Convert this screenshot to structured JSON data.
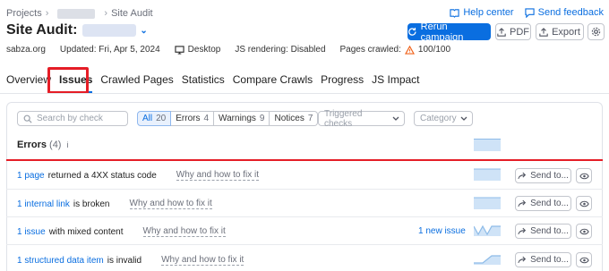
{
  "breadcrumb": {
    "root": "Projects",
    "current": "Site Audit",
    "separator": "›"
  },
  "header": {
    "title": "Site Audit:",
    "chevron": "⌄"
  },
  "top_links": {
    "help": "Help center",
    "feedback": "Send feedback"
  },
  "buttons": {
    "rerun": "Rerun campaign",
    "pdf": "PDF",
    "export": "Export"
  },
  "meta": {
    "domain": "sabza.org",
    "updated": "Updated: Fri, Apr 5, 2024",
    "device": "Desktop",
    "js": "JS rendering: Disabled",
    "crawled_label": "Pages crawled:",
    "crawled_value": "100/100"
  },
  "tabs": [
    {
      "label": "Overview"
    },
    {
      "label": "Issues"
    },
    {
      "label": "Crawled Pages"
    },
    {
      "label": "Statistics"
    },
    {
      "label": "Compare Crawls"
    },
    {
      "label": "Progress"
    },
    {
      "label": "JS Impact"
    }
  ],
  "filters": {
    "search_placeholder": "Search by check",
    "segments": [
      {
        "label": "All",
        "count": "20"
      },
      {
        "label": "Errors",
        "count": "4"
      },
      {
        "label": "Warnings",
        "count": "9"
      },
      {
        "label": "Notices",
        "count": "7"
      }
    ],
    "triggered": "Triggered checks",
    "category": "Category"
  },
  "section": {
    "title": "Errors",
    "count": "(4)",
    "info": "i"
  },
  "rows": [
    {
      "link": "1 page",
      "text": "returned a 4XX status code",
      "why": "Why and how to fix it",
      "new": "",
      "send": "Send to..."
    },
    {
      "link": "1 internal link",
      "text": "is broken",
      "why": "Why and how to fix it",
      "new": "",
      "send": "Send to..."
    },
    {
      "link": "1 issue",
      "text": "with mixed content",
      "why": "Why and how to fix it",
      "new": "1 new issue",
      "send": "Send to..."
    },
    {
      "link": "1 structured data item",
      "text": "is invalid",
      "why": "Why and how to fix it",
      "new": "",
      "send": "Send to..."
    }
  ],
  "colors": {
    "accent": "#0a6ee0",
    "highlight": "#e51d26",
    "warning": "#f0631c"
  }
}
